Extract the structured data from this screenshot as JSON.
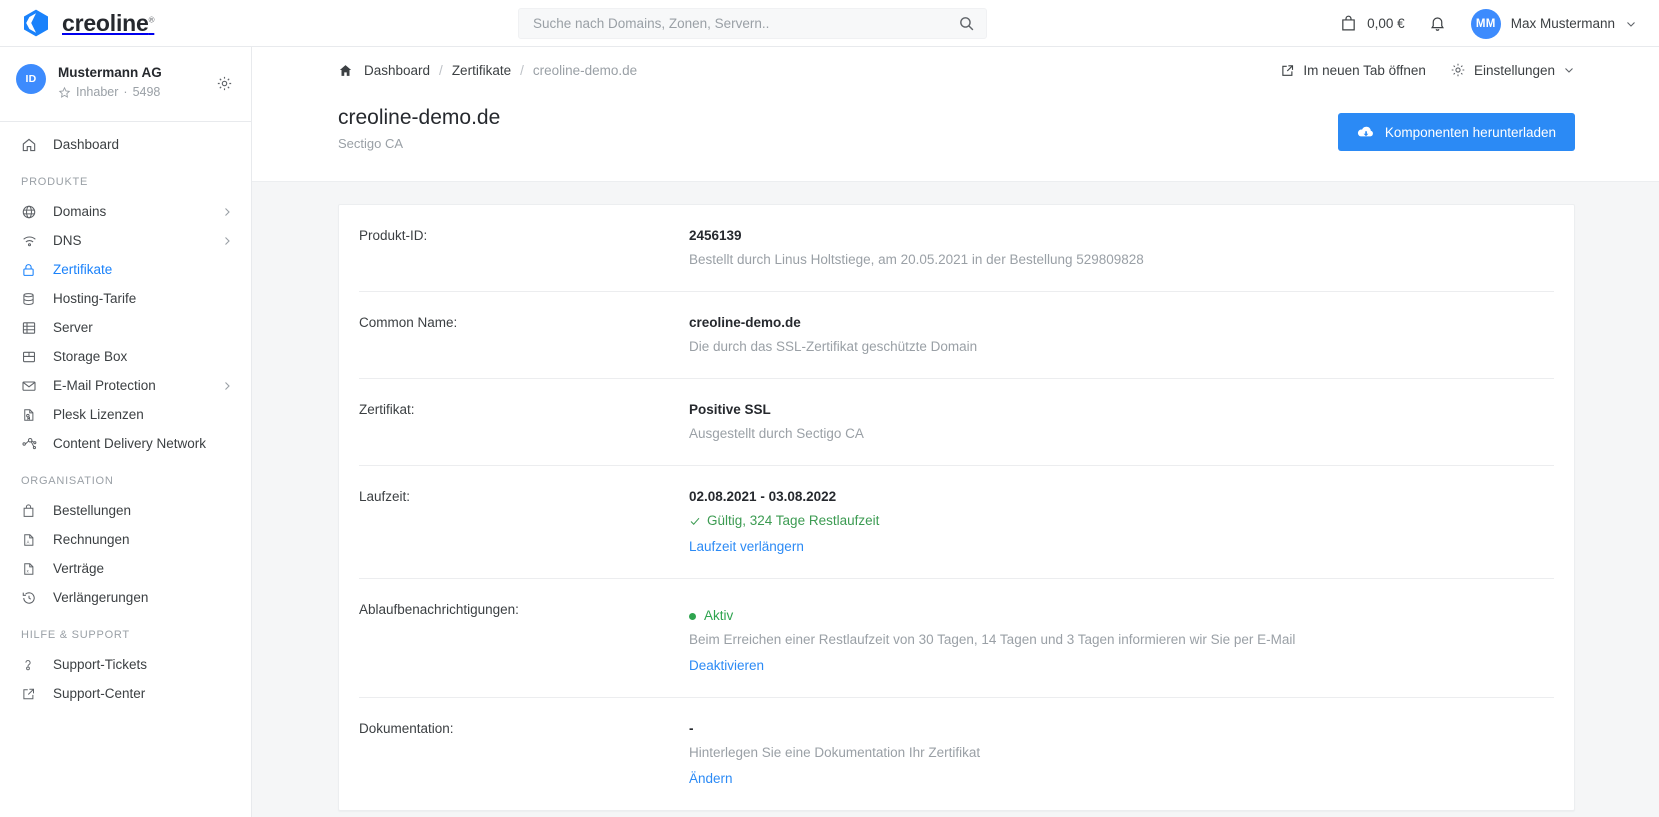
{
  "brand": {
    "name": "creoline",
    "reg": "®",
    "logo_icon": "creoline-hexagon-logo"
  },
  "search": {
    "placeholder": "Suche nach Domains, Zonen, Servern..",
    "value": "",
    "icon": "search-icon"
  },
  "topbar": {
    "cart_icon": "shopping-bag-icon",
    "cart_amount": "0,00 €",
    "bell_icon": "bell-icon",
    "user_initials": "MM",
    "user_name": "Max Mustermann",
    "user_chevron_icon": "chevron-down-icon"
  },
  "org": {
    "avatar_initials": "ID",
    "name": "Mustermann AG",
    "role": "Inhaber",
    "separator": "·",
    "id": "5498",
    "star_icon": "star-outline-icon",
    "gear_icon": "gear-icon"
  },
  "sidebar": {
    "top_items": [
      {
        "label": "Dashboard",
        "icon": "home-icon",
        "active": false,
        "chevron": false
      }
    ],
    "sections": [
      {
        "title": "PRODUKTE",
        "items": [
          {
            "label": "Domains",
            "icon": "globe-icon",
            "active": false,
            "chevron": true
          },
          {
            "label": "DNS",
            "icon": "dns-wifi-icon",
            "active": false,
            "chevron": true
          },
          {
            "label": "Zertifikate",
            "icon": "lock-icon",
            "active": true,
            "chevron": false
          },
          {
            "label": "Hosting-Tarife",
            "icon": "database-icon",
            "active": false,
            "chevron": false
          },
          {
            "label": "Server",
            "icon": "server-icon",
            "active": false,
            "chevron": false
          },
          {
            "label": "Storage Box",
            "icon": "storage-box-icon",
            "active": false,
            "chevron": false
          },
          {
            "label": "E-Mail Protection",
            "icon": "envelope-icon",
            "active": false,
            "chevron": true
          },
          {
            "label": "Plesk Lizenzen",
            "icon": "license-file-icon",
            "active": false,
            "chevron": false
          },
          {
            "label": "Content Delivery Network",
            "icon": "network-nodes-icon",
            "active": false,
            "chevron": false
          }
        ]
      },
      {
        "title": "ORGANISATION",
        "items": [
          {
            "label": "Bestellungen",
            "icon": "shopping-bag-icon",
            "active": false,
            "chevron": false
          },
          {
            "label": "Rechnungen",
            "icon": "pdf-file-icon",
            "active": false,
            "chevron": false
          },
          {
            "label": "Verträge",
            "icon": "contract-file-icon",
            "active": false,
            "chevron": false
          },
          {
            "label": "Verlängerungen",
            "icon": "history-clock-icon",
            "active": false,
            "chevron": false
          }
        ]
      },
      {
        "title": "HILFE & SUPPORT",
        "items": [
          {
            "label": "Support-Tickets",
            "icon": "question-help-icon",
            "active": false,
            "chevron": false
          },
          {
            "label": "Support-Center",
            "icon": "external-link-icon",
            "active": false,
            "chevron": false
          }
        ]
      }
    ]
  },
  "breadcrumb": {
    "home_icon": "home-filled-icon",
    "items": [
      {
        "label": "Dashboard",
        "current": false
      },
      {
        "label": "Zertifikate",
        "current": false
      },
      {
        "label": "creoline-demo.de",
        "current": true
      }
    ],
    "separator": "/"
  },
  "head_actions": [
    {
      "label": "Im neuen Tab öffnen",
      "icon": "external-link-icon",
      "chevron": false
    },
    {
      "label": "Einstellungen",
      "icon": "gear-icon",
      "chevron": true
    }
  ],
  "page": {
    "title": "creoline-demo.de",
    "subtitle": "Sectigo CA",
    "primary_button": {
      "label": "Komponenten herunterladen",
      "icon": "cloud-download-icon",
      "color": "#2b8af5"
    }
  },
  "details": [
    {
      "label": "Produkt-ID:",
      "value": "2456139",
      "sub": "Bestellt durch Linus Holtstiege, am 20.05.2021 in der Bestellung 529809828",
      "status": null,
      "link": null
    },
    {
      "label": "Common Name:",
      "value": "creoline-demo.de",
      "sub": "Die durch das SSL-Zertifikat geschützte Domain",
      "status": null,
      "link": null
    },
    {
      "label": "Zertifikat:",
      "value": "Positive SSL",
      "sub": "Ausgestellt durch Sectigo CA",
      "status": null,
      "link": null
    },
    {
      "label": "Laufzeit:",
      "value": "02.08.2021 - 03.08.2022",
      "sub": null,
      "status": {
        "type": "check",
        "text": "Gültig, 324 Tage Restlaufzeit",
        "color": "#3c9b52",
        "icon": "check-icon"
      },
      "link": "Laufzeit verlängern"
    },
    {
      "label": "Ablaufbenachrichtigungen:",
      "value": null,
      "sub": "Beim Erreichen einer Restlaufzeit von 30 Tagen, 14 Tagen und 3 Tagen informieren wir Sie per E-Mail",
      "status": {
        "type": "dot",
        "text": "Aktiv",
        "color": "#2ea44f",
        "icon": "status-dot-icon"
      },
      "link": "Deaktivieren"
    },
    {
      "label": "Dokumentation:",
      "value": "-",
      "sub": "Hinterlegen Sie eine Dokumentation Ihr Zertifikat",
      "status": null,
      "link": "Ändern"
    }
  ]
}
